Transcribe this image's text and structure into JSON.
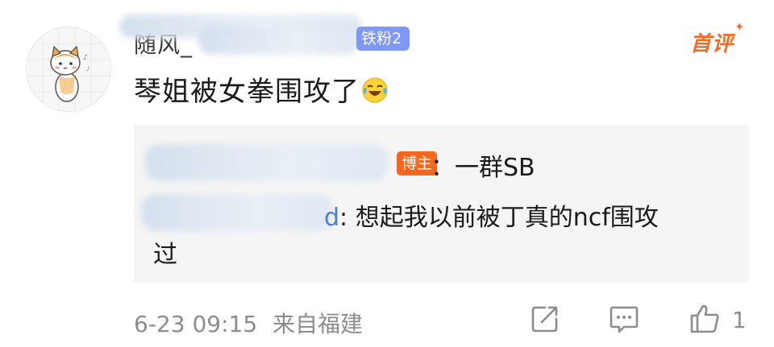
{
  "comment": {
    "username_visible": "随风_",
    "fan_badge": "铁粉2",
    "first_comment_label": "首评",
    "text": "琴姐被女拳围攻了",
    "emoji": "laughing-crying-emoji"
  },
  "replies": [
    {
      "author_badge": "博主",
      "text": "：一群SB"
    },
    {
      "author_suffix": "d",
      "text": ": 想起我以前被丁真的ncf围攻",
      "text_continued": "过"
    }
  ],
  "footer": {
    "timestamp": "6-23 09:15",
    "source": "来自福建",
    "like_count": "1"
  },
  "colors": {
    "accent_orange": "#f56b26",
    "fan_badge_blue": "#7f98f6",
    "link_blue": "#4a7fd6",
    "muted_gray": "#8c8c8c",
    "reply_bg": "#f5f5f5"
  }
}
